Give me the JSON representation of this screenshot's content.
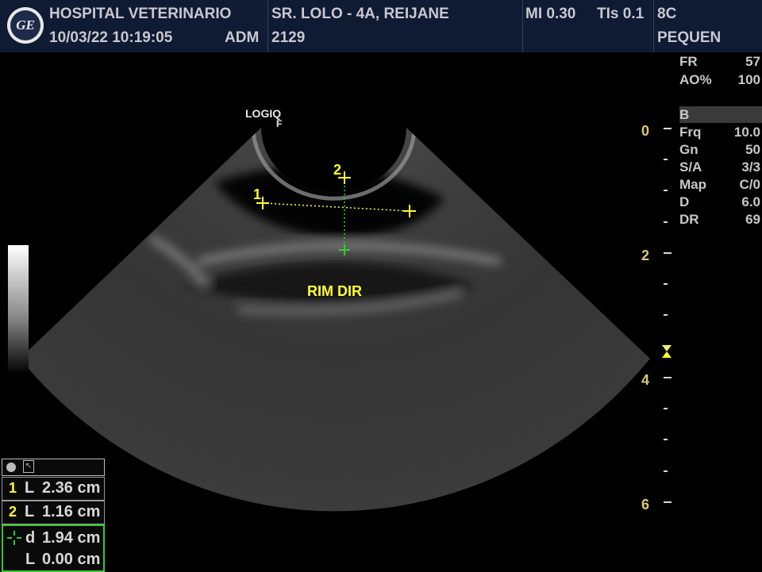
{
  "header": {
    "hospital": "HOSPITAL VETERINARIO",
    "datetime": "10/03/22 10:19:05",
    "operator": "ADM",
    "patient": "SR. LOLO - 4A, REIJANE",
    "patient_id": "2129",
    "mi": "MI 0.30",
    "tis": "TIs 0.1",
    "probe": "8C",
    "preset": "PEQUEN"
  },
  "params_top": [
    {
      "label": "FR",
      "value": "57"
    },
    {
      "label": "AO%",
      "value": "100"
    }
  ],
  "mode": "B",
  "params_b": [
    {
      "label": "Frq",
      "value": "10.0"
    },
    {
      "label": "Gn",
      "value": "50"
    },
    {
      "label": "S/A",
      "value": "3/3"
    },
    {
      "label": "Map",
      "value": "C/0"
    },
    {
      "label": "D",
      "value": "6.0"
    },
    {
      "label": "DR",
      "value": "69"
    }
  ],
  "depth_scale": [
    "0",
    "2",
    "4",
    "6"
  ],
  "image": {
    "probe_mark": "LOGIQ",
    "probe_mark_sub": "F",
    "annotation": "RIM DIR",
    "caliper1": "1",
    "caliper2": "2"
  },
  "measurements": [
    {
      "num": "1",
      "type": "L",
      "value": "2.36 cm"
    },
    {
      "num": "2",
      "type": "L",
      "value": "1.16 cm"
    }
  ],
  "cursor_meas": [
    {
      "type": "d",
      "value": "1.94 cm"
    },
    {
      "type": "L",
      "value": "0.00 cm"
    }
  ],
  "colors": {
    "header_bg": "#0f1a33",
    "caliper": "#ffff33",
    "cursor": "#33cc33",
    "scale": "#d8cc7a"
  }
}
